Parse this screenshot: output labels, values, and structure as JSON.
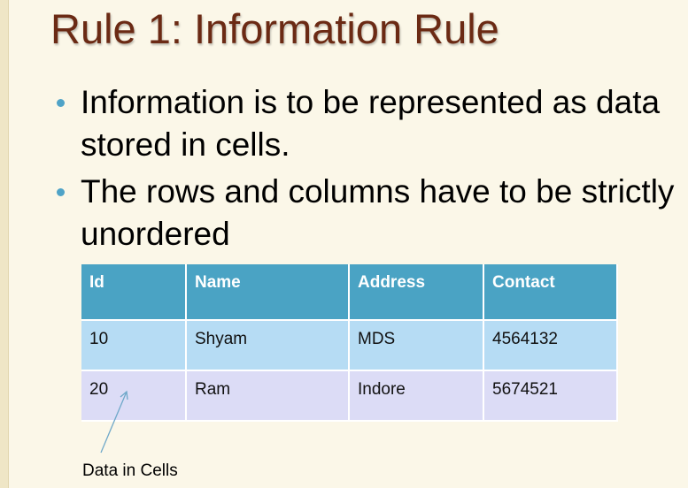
{
  "slide": {
    "title": "Rule 1: Information Rule",
    "bullets": [
      "Information is to be represented as data stored in cells.",
      "The rows and columns have to be strictly unordered"
    ]
  },
  "table": {
    "headers": [
      "Id",
      "Name",
      "Address",
      "Contact"
    ],
    "rows": [
      [
        "10",
        "Shyam",
        "MDS",
        "4564132"
      ],
      [
        "20",
        "Ram",
        "Indore",
        "5674521"
      ]
    ]
  },
  "annotation": {
    "label": "Data in Cells"
  },
  "colors": {
    "title": "#6b2a14",
    "bullet": "#4fa3c7",
    "header_bg": "#4aa3c4",
    "row1_bg": "#b6dcf4",
    "row2_bg": "#dcdcf6",
    "background": "#fbf7e8"
  }
}
